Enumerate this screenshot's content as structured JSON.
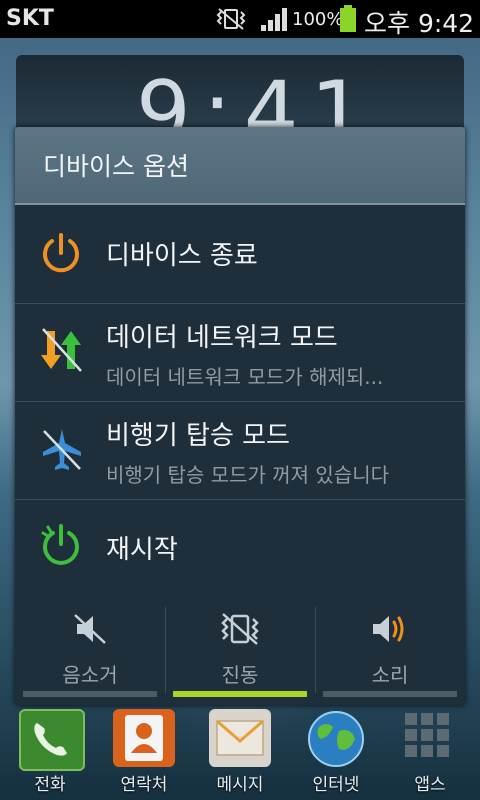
{
  "status_bar": {
    "carrier": "SKT",
    "battery_percent": "100%",
    "time": "오후 9:42",
    "battery_level": 100,
    "signal_bars": 4
  },
  "lock_clock": "9:41",
  "dialog": {
    "title": "디바이스 옵션",
    "items": [
      {
        "title": "디바이스 종료",
        "subtitle": "",
        "icon": "power-icon",
        "icon_color": "#f0901e"
      },
      {
        "title": "데이터 네트워크 모드",
        "subtitle": "데이터 네트워크 모드가 해제되...",
        "icon": "data-network-off-icon",
        "icon_color": "#f0a020"
      },
      {
        "title": "비행기 탑승 모드",
        "subtitle": "비행기 탑승 모드가 꺼져 있습니다",
        "icon": "airplane-icon",
        "icon_color": "#3a8fd8"
      },
      {
        "title": "재시작",
        "subtitle": "",
        "icon": "restart-icon",
        "icon_color": "#3cbf3c"
      }
    ],
    "sound_modes": [
      {
        "label": "음소거",
        "icon": "mute-icon",
        "active": false
      },
      {
        "label": "진동",
        "icon": "vibrate-icon",
        "active": true
      },
      {
        "label": "소리",
        "icon": "sound-icon",
        "active": false
      }
    ],
    "active_indicator_color": "#a9d42c"
  },
  "dock": [
    {
      "label": "전화",
      "icon": "phone-app-icon"
    },
    {
      "label": "연락처",
      "icon": "contacts-app-icon"
    },
    {
      "label": "메시지",
      "icon": "messages-app-icon"
    },
    {
      "label": "인터넷",
      "icon": "internet-app-icon"
    },
    {
      "label": "앱스",
      "icon": "apps-grid-icon"
    }
  ]
}
